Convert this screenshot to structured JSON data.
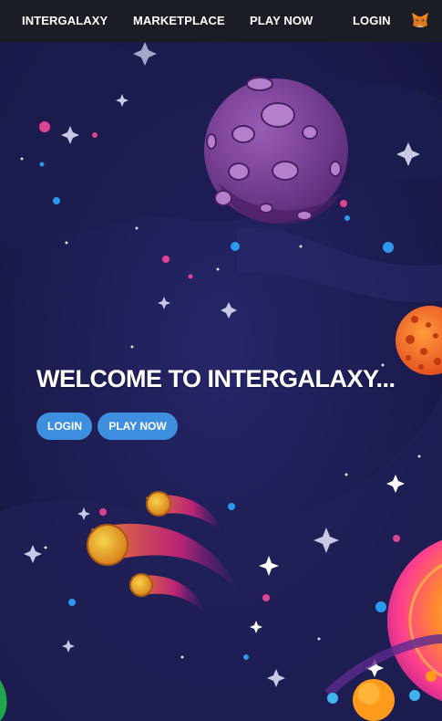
{
  "nav": {
    "links": [
      "INTERGALAXY",
      "MARKETPLACE",
      "PLAY NOW",
      "LOGIN"
    ],
    "wallet_icon": "metamask-fox-icon"
  },
  "hero": {
    "title": "WELCOME TO INTERGALAXY...",
    "login_label": "LOGIN",
    "play_label": "PLAY NOW"
  },
  "colors": {
    "nav_bg": "#1b1d24",
    "space_bg": "#1a1a44",
    "button": "#3f8fe0",
    "planet_purple": "#7a3f95",
    "planet_orange": "#f26a1b"
  }
}
